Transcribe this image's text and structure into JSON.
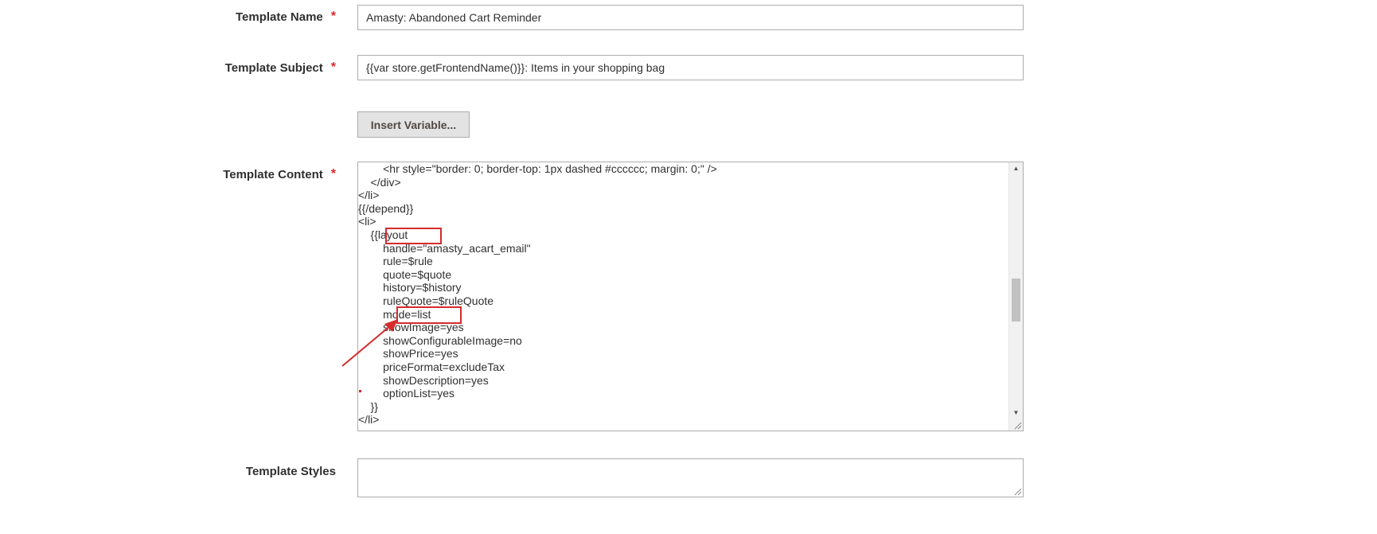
{
  "form": {
    "template_name": {
      "label": "Template Name",
      "required_mark": "*",
      "value": "Amasty: Abandoned Cart Reminder"
    },
    "template_subject": {
      "label": "Template Subject",
      "required_mark": "*",
      "value": "{{var store.getFrontendName()}}: Items in your shopping bag"
    },
    "insert_variable_button": {
      "label": "Insert Variable..."
    },
    "template_content": {
      "label": "Template Content",
      "required_mark": "*",
      "lines": [
        "        <hr style=\"border: 0; border-top: 1px dashed #cccccc; margin: 0;\" />",
        "    </div>",
        "</li>",
        "{{/depend}}",
        "<li>",
        "    {{layout",
        "        handle=\"amasty_acart_email\"",
        "        rule=$rule",
        "        quote=$quote",
        "        history=$history",
        "        ruleQuote=$ruleQuote",
        "        mode=list",
        "        showImage=yes",
        "        showConfigurableImage=no",
        "        showPrice=yes",
        "        priceFormat=excludeTax",
        "        showDescription=yes",
        "        optionList=yes",
        "    }}",
        "</li>"
      ]
    },
    "template_styles": {
      "label": "Template Styles",
      "value": ""
    }
  },
  "annotations": {
    "highlight_color": "#d62b2b",
    "arrow_color": "#d62b2b",
    "required_color": "#e22626"
  },
  "icons": {
    "scroll_up": "scroll-up-arrow-icon",
    "scroll_down": "scroll-down-arrow-icon",
    "resize": "resize-grip-icon"
  }
}
